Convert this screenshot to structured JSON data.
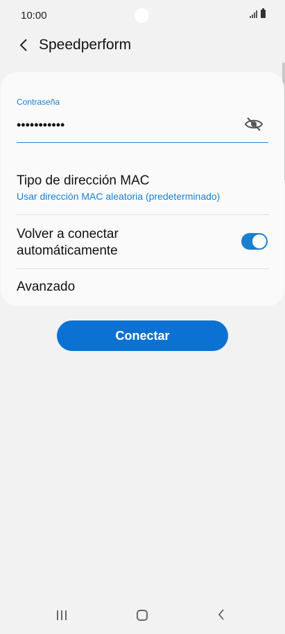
{
  "status_bar": {
    "time": "10:00",
    "icons": [
      "signal-icon",
      "battery-icon"
    ]
  },
  "header": {
    "back_icon": "chevron-left-icon",
    "title": "Speedperform"
  },
  "password": {
    "label": "Contraseña",
    "value": "•••••••••••",
    "visibility_icon": "eye-off-icon"
  },
  "mac_address": {
    "title": "Tipo de dirección MAC",
    "value": "Usar dirección MAC aleatoria (predeterminado)"
  },
  "auto_reconnect": {
    "label": "Volver a conectar automáticamente",
    "enabled": true
  },
  "advanced": {
    "label": "Avanzado"
  },
  "connect_button": {
    "label": "Conectar"
  },
  "nav_bar": {
    "icons": [
      "recents-icon",
      "home-icon",
      "back-icon"
    ]
  },
  "colors": {
    "accent": "#1a7fd0",
    "button": "#0b72d3",
    "background": "#f2f2f2",
    "card": "#fafafa"
  }
}
